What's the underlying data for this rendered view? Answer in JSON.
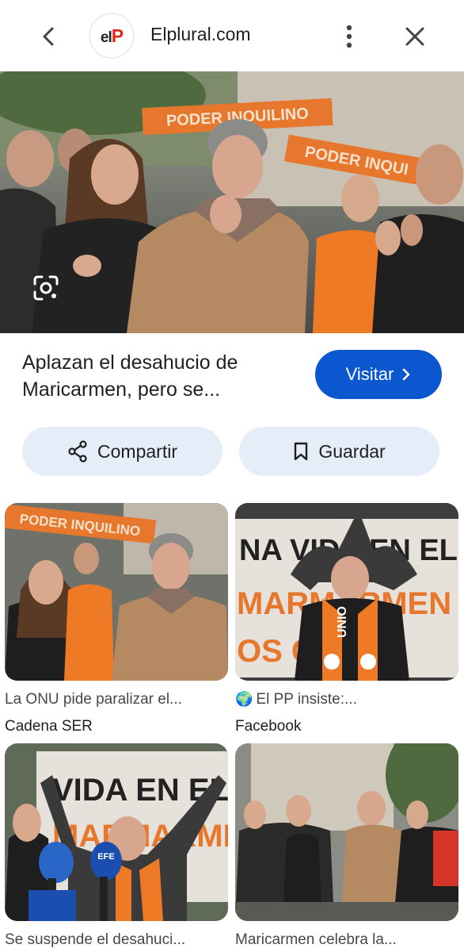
{
  "header": {
    "logo_text_el": "el",
    "logo_text_p": "P",
    "site_name": "Elplural.com"
  },
  "hero": {
    "banner_1": "PODER INQUILINO",
    "banner_2": "PODER INQUI"
  },
  "result": {
    "title": "Aplazan el desahucio de Maricarmen, pero se...",
    "visit_label": "Visitar"
  },
  "actions": {
    "share_label": "Compartir",
    "save_label": "Guardar"
  },
  "related": [
    {
      "title": "La ONU pide paralizar el...",
      "source": "Cadena SER",
      "thumb_text": "PODER INQUILINO"
    },
    {
      "title": "El PP insiste:...",
      "source": "Facebook",
      "thumb_text": "NA VIDA EN EL",
      "thumb_text_2": "MARMARMEN",
      "thumb_text_3": "OS OL",
      "scarf_text": "UNIO"
    },
    {
      "title": "Se suspende el desahuci...",
      "source": "",
      "thumb_text": "VIDA EN EL",
      "thumb_text_2": "MARMARME",
      "mic_text": "EFE"
    },
    {
      "title": "Maricarmen celebra la...",
      "source": ""
    }
  ],
  "colors": {
    "accent_blue": "#0b57d0",
    "tonal_button": "#e5edf8",
    "banner_orange": "#e8772e"
  }
}
